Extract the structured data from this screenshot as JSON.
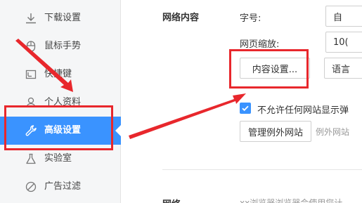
{
  "sidebar": {
    "items": [
      {
        "label": "下载设置",
        "icon": "download-icon"
      },
      {
        "label": "鼠标手势",
        "icon": "mouse-icon"
      },
      {
        "label": "快捷键",
        "icon": "keyboard-icon"
      },
      {
        "label": "个人资料",
        "icon": "user-icon"
      },
      {
        "label": "高级设置",
        "icon": "wrench-icon",
        "active": true
      },
      {
        "label": "实验室",
        "icon": "flask-icon"
      },
      {
        "label": "广告过滤",
        "icon": "block-icon"
      }
    ]
  },
  "web_content": {
    "title": "网络内容",
    "font_size_label": "字号:",
    "font_size_value": "自",
    "zoom_label": "网页缩放:",
    "zoom_value": "10(",
    "content_settings_button": "内容设置...",
    "language_button": "语言",
    "block_popups_checkbox": "不允许任何网站显示弹",
    "block_popups_checked": true,
    "manage_exceptions_button": "管理例外网站",
    "exceptions_hint": "例外网站"
  },
  "next_section": {
    "title": "网络",
    "hint": "xx浏览器浏览器会使用您计"
  },
  "colors": {
    "accent": "#3a93ff",
    "annotation": "#e8272c",
    "sidebar_bg": "#f5f6f7"
  }
}
